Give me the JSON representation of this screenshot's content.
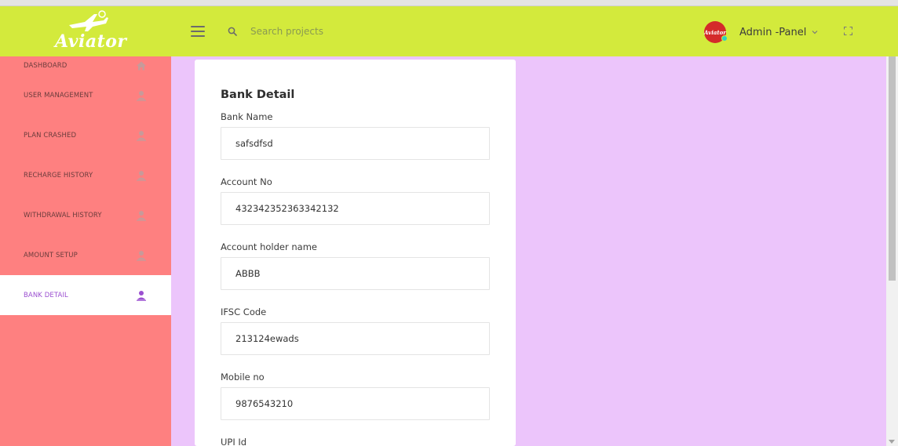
{
  "app": {
    "logo_text": "Aviator",
    "logo_icon": "plane-icon"
  },
  "header": {
    "menu_icon": "hamburger-icon",
    "search_placeholder": "Search projects",
    "user_name": "Admin -Panel",
    "avatar_text": "Aviator",
    "fullscreen_icon": "fullscreen-icon"
  },
  "sidebar": {
    "items": [
      {
        "label": "DASHBOARD",
        "icon": "home-icon"
      },
      {
        "label": "USER MANAGEMENT",
        "icon": "user-icon"
      },
      {
        "label": "PLAN CRASHED",
        "icon": "user-icon"
      },
      {
        "label": "RECHARGE HISTORY",
        "icon": "user-icon"
      },
      {
        "label": "WITHDRAWAL HISTORY",
        "icon": "user-icon"
      },
      {
        "label": "AMOUNT SETUP",
        "icon": "user-icon"
      },
      {
        "label": "BANK DETAIL",
        "icon": "user-icon",
        "active": true
      }
    ]
  },
  "form": {
    "title": "Bank Detail",
    "fields": [
      {
        "label": "Bank Name",
        "value": "safsdfsd"
      },
      {
        "label": "Account No",
        "value": "432342352363342132"
      },
      {
        "label": "Account holder name",
        "value": "ABBB"
      },
      {
        "label": "IFSC Code",
        "value": "213124ewads"
      },
      {
        "label": "Mobile no",
        "value": "9876543210"
      },
      {
        "label": "UPI Id",
        "value": ""
      }
    ]
  },
  "colors": {
    "topbar": "#d3ea3c",
    "sidebar": "#fe8080",
    "content_bg": "#ecc5fb",
    "active_text": "#9b4fd0"
  }
}
